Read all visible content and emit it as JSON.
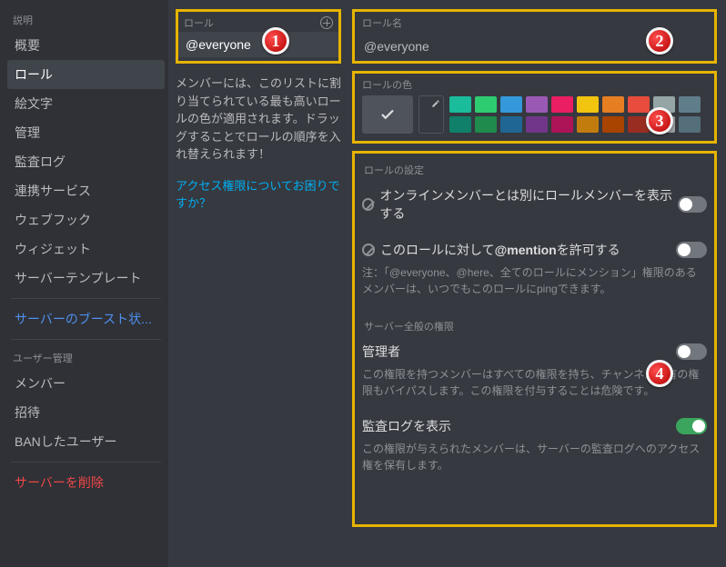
{
  "sidebar": {
    "section1_label": "説明",
    "items1": [
      "概要",
      "ロール",
      "絵文字",
      "管理",
      "監査ログ",
      "連携サービス",
      "ウェブフック",
      "ウィジェット",
      "サーバーテンプレート"
    ],
    "boost": "サーバーのブースト状...",
    "section2_label": "ユーザー管理",
    "items2": [
      "メンバー",
      "招待",
      "BANしたユーザー"
    ],
    "delete": "サーバーを削除"
  },
  "roles_col": {
    "heading": "ロール",
    "list": [
      "@everyone"
    ],
    "hint": "メンバーには、このリストに割り当てられている最も高いロールの色が適用されます。ドラッグすることでロールの順序を入れ替えられます！",
    "link": "アクセス権限についてお困りですか？"
  },
  "role_name": {
    "label": "ロール名",
    "value": "@everyone"
  },
  "role_color": {
    "label": "ロールの色",
    "swatches_row1": [
      "#1abc9c",
      "#2ecc71",
      "#3498db",
      "#9b59b6",
      "#e91e63",
      "#f1c40f",
      "#e67e22",
      "#e74c3c",
      "#95a5a6",
      "#607d8b"
    ],
    "swatches_row2": [
      "#11806a",
      "#1f8b4c",
      "#206694",
      "#71368a",
      "#ad1457",
      "#c27c0e",
      "#a84300",
      "#992d22",
      "#979c9f",
      "#546e7a"
    ]
  },
  "settings": {
    "section1": "ロールの設定",
    "perm1": {
      "label": "オンラインメンバーとは別にロールメンバーを表示する"
    },
    "perm2": {
      "label_pre": "このロールに対して",
      "label_bold": "@mention",
      "label_post": "を許可する",
      "desc": "注：「@everyone、@here、全てのロールにメンション」権限のあるメンバーは、いつでもこのロールにpingできます。"
    },
    "section2": "サーバー全般の権限",
    "perm3": {
      "label": "管理者",
      "desc": "この権限を持つメンバーはすべての権限を持ち、チャンネル固有の権限もバイパスします。この権限を付与することは危険です。"
    },
    "perm4": {
      "label": "監査ログを表示",
      "desc": "この権限が与えられたメンバーは、サーバーの監査ログへのアクセス権を保有します。"
    }
  },
  "badges": [
    "1",
    "2",
    "3",
    "4"
  ]
}
